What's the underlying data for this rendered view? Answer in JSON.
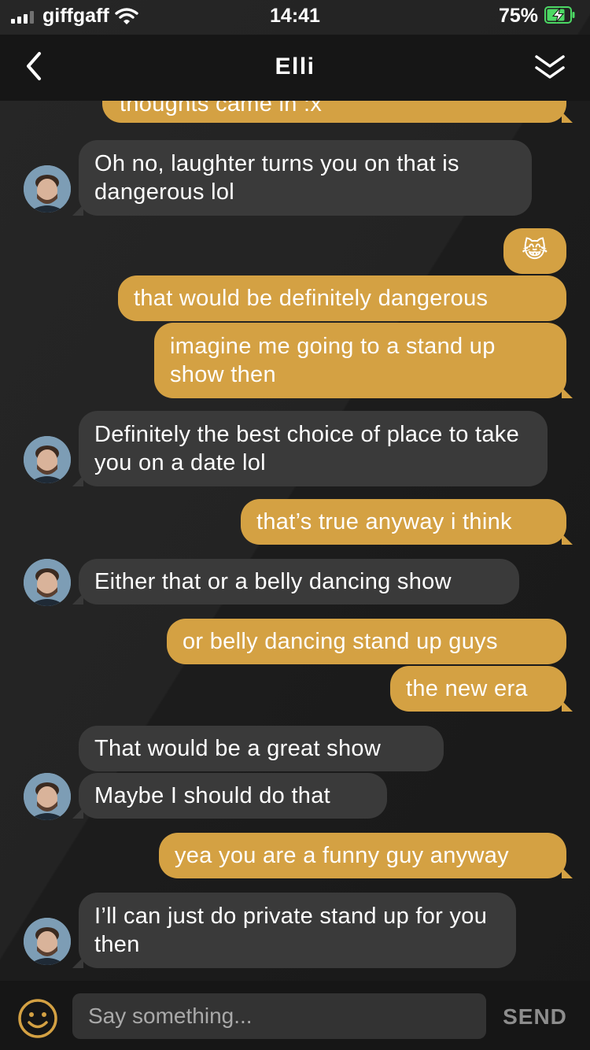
{
  "status_bar": {
    "carrier": "giffgaff",
    "time": "14:41",
    "battery_percent": "75%"
  },
  "header": {
    "title": "Elli",
    "back_icon": "chevron-left-icon",
    "collapse_icon": "double-chevron-down-icon"
  },
  "colors": {
    "outgoing_bubble": "#d4a143",
    "incoming_bubble": "#3a3a3a",
    "background": "#1b1b1b"
  },
  "messages": [
    {
      "from": "me",
      "text": "thoughts came in :x"
    },
    {
      "from": "them",
      "text": "Oh no, laughter turns you on that is dangerous lol"
    },
    {
      "from": "me",
      "text": "😹"
    },
    {
      "from": "me",
      "text": "that would be definitely dangerous"
    },
    {
      "from": "me",
      "text": "imagine me going to a stand up show then"
    },
    {
      "from": "them",
      "text": "Definitely the best choice of place to take you on a date lol"
    },
    {
      "from": "me",
      "text": "that’s true anyway i think"
    },
    {
      "from": "them",
      "text": "Either that or a belly dancing show"
    },
    {
      "from": "me",
      "text": "or belly dancing stand up guys"
    },
    {
      "from": "me",
      "text": "the new era"
    },
    {
      "from": "them",
      "text": "That would be a great show"
    },
    {
      "from": "them",
      "text": "Maybe I should do that"
    },
    {
      "from": "me",
      "text": "yea you are a funny guy anyway"
    },
    {
      "from": "them",
      "text": "I’ll can just do private stand up for you then"
    }
  ],
  "composer": {
    "placeholder": "Say something...",
    "send_label": "SEND",
    "emoji_icon": "smiley-icon"
  }
}
